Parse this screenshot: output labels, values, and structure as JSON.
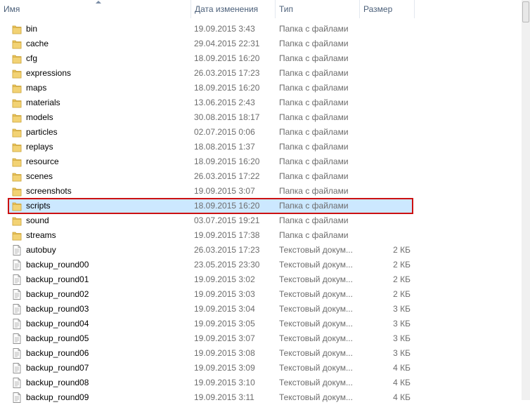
{
  "columns": {
    "name": "Имя",
    "date": "Дата изменения",
    "type": "Тип",
    "size": "Размер"
  },
  "files": [
    {
      "name": "bin",
      "date": "19.09.2015 3:43",
      "type": "Папка с файлами",
      "size": "",
      "icon": "folder-icon"
    },
    {
      "name": "cache",
      "date": "29.04.2015 22:31",
      "type": "Папка с файлами",
      "size": "",
      "icon": "folder-icon"
    },
    {
      "name": "cfg",
      "date": "18.09.2015 16:20",
      "type": "Папка с файлами",
      "size": "",
      "icon": "folder-icon"
    },
    {
      "name": "expressions",
      "date": "26.03.2015 17:23",
      "type": "Папка с файлами",
      "size": "",
      "icon": "folder-icon"
    },
    {
      "name": "maps",
      "date": "18.09.2015 16:20",
      "type": "Папка с файлами",
      "size": "",
      "icon": "folder-icon"
    },
    {
      "name": "materials",
      "date": "13.06.2015 2:43",
      "type": "Папка с файлами",
      "size": "",
      "icon": "folder-icon"
    },
    {
      "name": "models",
      "date": "30.08.2015 18:17",
      "type": "Папка с файлами",
      "size": "",
      "icon": "folder-icon"
    },
    {
      "name": "particles",
      "date": "02.07.2015 0:06",
      "type": "Папка с файлами",
      "size": "",
      "icon": "folder-icon"
    },
    {
      "name": "replays",
      "date": "18.08.2015 1:37",
      "type": "Папка с файлами",
      "size": "",
      "icon": "folder-icon"
    },
    {
      "name": "resource",
      "date": "18.09.2015 16:20",
      "type": "Папка с файлами",
      "size": "",
      "icon": "folder-icon"
    },
    {
      "name": "scenes",
      "date": "26.03.2015 17:22",
      "type": "Папка с файлами",
      "size": "",
      "icon": "folder-icon"
    },
    {
      "name": "screenshots",
      "date": "19.09.2015 3:07",
      "type": "Папка с файлами",
      "size": "",
      "icon": "folder-icon"
    },
    {
      "name": "scripts",
      "date": "18.09.2015 16:20",
      "type": "Папка с файлами",
      "size": "",
      "icon": "folder-icon",
      "selected": true
    },
    {
      "name": "sound",
      "date": "03.07.2015 19:21",
      "type": "Папка с файлами",
      "size": "",
      "icon": "folder-icon"
    },
    {
      "name": "streams",
      "date": "19.09.2015 17:38",
      "type": "Папка с файлами",
      "size": "",
      "icon": "folder-icon"
    },
    {
      "name": "autobuy",
      "date": "26.03.2015 17:23",
      "type": "Текстовый докум...",
      "size": "2 КБ",
      "icon": "text-file-icon"
    },
    {
      "name": "backup_round00",
      "date": "23.05.2015 23:30",
      "type": "Текстовый докум...",
      "size": "2 КБ",
      "icon": "text-file-icon"
    },
    {
      "name": "backup_round01",
      "date": "19.09.2015 3:02",
      "type": "Текстовый докум...",
      "size": "2 КБ",
      "icon": "text-file-icon"
    },
    {
      "name": "backup_round02",
      "date": "19.09.2015 3:03",
      "type": "Текстовый докум...",
      "size": "2 КБ",
      "icon": "text-file-icon"
    },
    {
      "name": "backup_round03",
      "date": "19.09.2015 3:04",
      "type": "Текстовый докум...",
      "size": "3 КБ",
      "icon": "text-file-icon"
    },
    {
      "name": "backup_round04",
      "date": "19.09.2015 3:05",
      "type": "Текстовый докум...",
      "size": "3 КБ",
      "icon": "text-file-icon"
    },
    {
      "name": "backup_round05",
      "date": "19.09.2015 3:07",
      "type": "Текстовый докум...",
      "size": "3 КБ",
      "icon": "text-file-icon"
    },
    {
      "name": "backup_round06",
      "date": "19.09.2015 3:08",
      "type": "Текстовый докум...",
      "size": "3 КБ",
      "icon": "text-file-icon"
    },
    {
      "name": "backup_round07",
      "date": "19.09.2015 3:09",
      "type": "Текстовый докум...",
      "size": "4 КБ",
      "icon": "text-file-icon"
    },
    {
      "name": "backup_round08",
      "date": "19.09.2015 3:10",
      "type": "Текстовый докум...",
      "size": "4 КБ",
      "icon": "text-file-icon"
    },
    {
      "name": "backup_round09",
      "date": "19.09.2015 3:11",
      "type": "Текстовый докум...",
      "size": "4 КБ",
      "icon": "text-file-icon"
    }
  ],
  "colors": {
    "selection_fill": "#cce8ff",
    "highlight_border": "#cc1111",
    "folder": "#e8c25a"
  }
}
